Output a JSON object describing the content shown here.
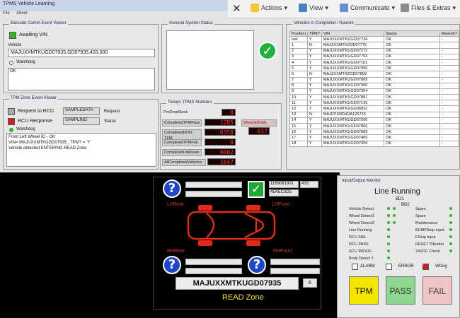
{
  "window": {
    "title": "TPMS Vehicle Learning",
    "menu": [
      "File",
      "About"
    ]
  },
  "ribbon": {
    "actions": "Actions",
    "view": "View",
    "communicate": "Communicate",
    "files": "Files & Extras"
  },
  "barcode": {
    "legend": "Barcode Comm Event Viewer",
    "status": "Awaiting VIN",
    "vehicle_label": "Vehicle",
    "vehicle_value": "MAJUXXMTKUGD07935,GD07935,433,000",
    "watchdog_label": "Watchdog",
    "ok_text": "OK"
  },
  "general": {
    "legend": "General System Status"
  },
  "tpm_zone": {
    "legend": "TPM Zone Event Viewer",
    "request_label": "Request to RCU",
    "request_value": "SAMPLEDATA",
    "request_tag": "Request",
    "response_label": "RCU Response",
    "response_value": "SAMPLING",
    "response_tag": "Status",
    "watchdog_label": "Watchdog",
    "log": [
      "Front Left Wheel ID - OK",
      "VIN= MAJUXXMTKUGD07935 , TPM? = 'Y'",
      "Vehicle detected ENTERING READ Zone"
    ]
  },
  "stats": {
    "legend": "Todays TPMS Statistics",
    "predropstock_label": "PreDropStock",
    "predropstock_value": "0",
    "rows": [
      {
        "label": "CompletedTPMPass",
        "value": "1285"
      },
      {
        "label": "CompletedNON-TPM",
        "value": "0358"
      },
      {
        "label": "CompletedTPMFail",
        "value": "0"
      },
      {
        "label": "CompletedUnknown",
        "value": "0002"
      },
      {
        "label": "AllCompletedVehicles",
        "value": "1647"
      }
    ],
    "wheelidfails_label": "WheelIDFails",
    "wheelidfails_value": "017"
  },
  "vehicles": {
    "legend": "Vehicles in Completed / Rework",
    "columns": [
      "Position",
      "TPM?",
      "VIN",
      "Status",
      "Rework?"
    ],
    "rows": [
      [
        "last",
        "Y",
        "MAJUXXMTKUGD07734",
        "OK",
        "-"
      ],
      [
        "1",
        "N",
        "MAJZXXMTKZGD07775",
        "OK",
        "-"
      ],
      [
        "2",
        "Y",
        "MAJUXXMTKUGD07272",
        "OK",
        "-"
      ],
      [
        "3",
        "Y",
        "MAJUXXMTKUGD07793",
        "OK",
        "-"
      ],
      [
        "4",
        "Y",
        "MAJUXXMTKUGD07162",
        "OK",
        "-"
      ],
      [
        "5",
        "Y",
        "MAJUXXMTKUGD07895",
        "OK",
        "-"
      ],
      [
        "6",
        "N",
        "MAJZXXMTKZGD07809",
        "OK",
        "-"
      ],
      [
        "7",
        "Y",
        "MAJUXXMTKUGD07869",
        "OK",
        "-"
      ],
      [
        "8",
        "Y",
        "MAJUXXMTKUGD07360",
        "OK",
        "-"
      ],
      [
        "9",
        "Y",
        "MAJUXXMTKUGD07364",
        "OK",
        "-"
      ],
      [
        "10",
        "Y",
        "MAJUXXMTKUGD07881",
        "OK",
        "-"
      ],
      [
        "11",
        "Y",
        "MAJUXXMTKUGD07135",
        "OK",
        "-"
      ],
      [
        "12",
        "Y",
        "MAJUXXMTKUGD06892",
        "OK",
        "-"
      ],
      [
        "13",
        "N",
        "MAJFP1MD4GA125733",
        "OK",
        "-"
      ],
      [
        "14",
        "Y",
        "MAJUXXMTKUGD07696",
        "OK",
        "-"
      ],
      [
        "15",
        "Y",
        "MAJUXXMTKUGD07806",
        "OK",
        "-"
      ],
      [
        "16",
        "Y",
        "MAJUXXMTKUGD07869",
        "OK",
        "-"
      ],
      [
        "17",
        "Y",
        "MAJUXXMTKUGD07405",
        "OK",
        "-"
      ],
      [
        "18",
        "Y",
        "MAJUXXMTKUGD07356",
        "OK",
        "-"
      ]
    ]
  },
  "read_zone": {
    "lhrear": "LHRear",
    "lhfront": "LHFront",
    "rhrear": "RHRear",
    "rhfront": "RHFront",
    "sensor_id": "1169081301",
    "sensor_pressure": "433",
    "sensor_hex": "45AEC3D5",
    "vin": "MAJUXXMTKUGD07935",
    "count": "6",
    "zone_label": "READ Zone"
  },
  "io": {
    "legend": "Input/Output Monitor",
    "title": "Line Running",
    "bd1": "BD1",
    "bd2": "BD2",
    "left": [
      "Vehicle Detect",
      "Wheel Detect1",
      "Wheel Detect2",
      "Line Running",
      "RCU FAIL",
      "RCU PASS",
      "RCU W/DOG",
      "Body Detect 3"
    ],
    "right": [
      "Spare",
      "Spare",
      "Maintenance",
      "BUMPStop input",
      "EStop input",
      "RESET P/button",
      "24VDC Check"
    ],
    "alarm": "ALARM",
    "error": "ERROR",
    "wdog": "WDog",
    "tpm": "TPM",
    "pass": "PASS",
    "fail": "FAIL"
  },
  "colors": {
    "accent_green": "#2db52d",
    "alarm_red": "#d12020",
    "tpm_yellow": "#f2e600",
    "pass_green": "#8fd68f",
    "fail_pink": "#f0c4c4",
    "segment_red": "#ff3b2b"
  }
}
